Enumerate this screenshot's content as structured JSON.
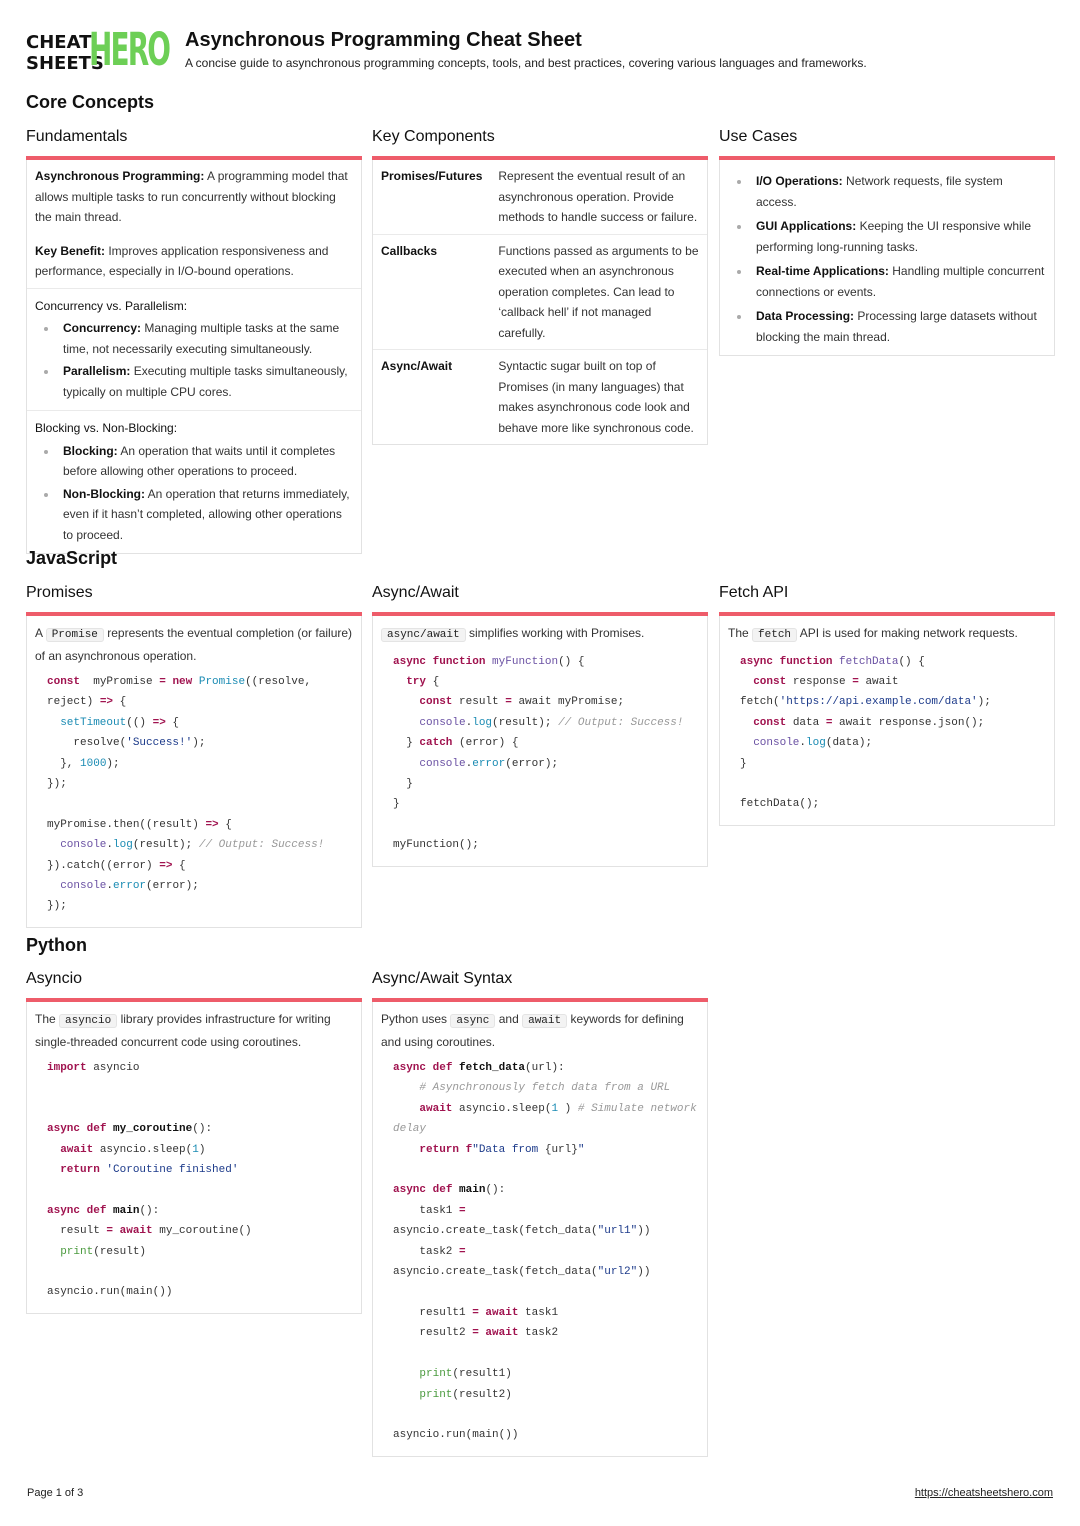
{
  "logo": {
    "line1": "CHEAT",
    "line2": "SHEETS",
    "hero": "HERO"
  },
  "header": {
    "title": "Asynchronous Programming Cheat Sheet",
    "subtitle": "A concise guide to asynchronous programming concepts, tools, and best practices, covering various languages and frameworks."
  },
  "sections": {
    "core": "Core Concepts",
    "javascript": "JavaScript",
    "python": "Python"
  },
  "fundamentals": {
    "title": "Fundamentals",
    "p1_bold": "Asynchronous Programming:",
    "p1_text": " A programming model that allows multiple tasks to run concurrently without blocking the main thread.",
    "p2_bold": "Key Benefit:",
    "p2_text": " Improves application responsiveness and performance, especially in I/O-bound operations.",
    "cp_heading": "Concurrency vs. Parallelism:",
    "cp_items": [
      {
        "bold": "Concurrency:",
        "text": " Managing multiple tasks at the same time, not necessarily executing simultaneously."
      },
      {
        "bold": "Parallelism:",
        "text": " Executing multiple tasks simultaneously, typically on multiple CPU cores."
      }
    ],
    "bn_heading": "Blocking vs. Non-Blocking:",
    "bn_items": [
      {
        "bold": "Blocking:",
        "text": " An operation that waits until it completes before allowing other operations to proceed."
      },
      {
        "bold": "Non-Blocking:",
        "text": " An operation that returns immediately, even if it hasn’t completed, allowing other operations to proceed."
      }
    ]
  },
  "key_components": {
    "title": "Key Components",
    "rows": [
      {
        "term": "Promises/Futures",
        "desc": "Represent the eventual result of an asynchronous operation. Provide methods to handle success or failure."
      },
      {
        "term": "Callbacks",
        "desc": "Functions passed as arguments to be executed when an asynchronous operation completes. Can lead to ‘callback hell’ if not managed carefully."
      },
      {
        "term": "Async/Await",
        "desc": "Syntactic sugar built on top of Promises (in many languages) that makes asynchronous code look and behave more like synchronous code."
      }
    ]
  },
  "use_cases": {
    "title": "Use Cases",
    "items": [
      {
        "bold": "I/O Operations:",
        "text": " Network requests, file system access."
      },
      {
        "bold": "GUI Applications:",
        "text": " Keeping the UI responsive while performing long-running tasks."
      },
      {
        "bold": "Real-time Applications:",
        "text": " Handling multiple concurrent connections or events."
      },
      {
        "bold": "Data Processing:",
        "text": " Processing large datasets without blocking the main thread."
      }
    ]
  },
  "promises": {
    "title": "Promises",
    "intro_pre": "A ",
    "intro_code": "Promise",
    "intro_post": " represents the eventual completion (or failure) of an asynchronous operation."
  },
  "js_async_await": {
    "title": "Async/Await",
    "intro_code": "async/await",
    "intro_post": " simplifies working with Promises."
  },
  "fetch_api": {
    "title": "Fetch API",
    "intro_pre": "The ",
    "intro_code": "fetch",
    "intro_post": " API is used for making network requests."
  },
  "asyncio": {
    "title": "Asyncio",
    "intro_pre": "The ",
    "intro_code": "asyncio",
    "intro_post": " library provides infrastructure for writing single-threaded concurrent code using coroutines."
  },
  "py_async_await": {
    "title": "Async/Await Syntax",
    "intro_pre": "Python uses ",
    "intro_code1": "async",
    "intro_mid": " and ",
    "intro_code2": "await",
    "intro_post": " keywords for defining and using coroutines."
  },
  "code": {
    "promises": [
      [
        [
          "kw",
          "const"
        ],
        [
          "",
          "  myPromise "
        ],
        [
          "op",
          "="
        ],
        [
          "",
          ""
        ],
        [
          "kw",
          " new"
        ],
        [
          "bi",
          " Promise"
        ],
        [
          "",
          "((resolve,"
        ]
      ],
      [
        [
          "",
          "reject) "
        ],
        [
          "op",
          "=>"
        ],
        [
          "",
          " {"
        ]
      ],
      [
        [
          "",
          "  "
        ],
        [
          "bi",
          "setTimeout"
        ],
        [
          "",
          "(() "
        ],
        [
          "op",
          "=>"
        ],
        [
          "",
          " {"
        ]
      ],
      [
        [
          "",
          "    resolve("
        ],
        [
          "str",
          "'Success!'"
        ],
        [
          "",
          ");"
        ]
      ],
      [
        [
          "",
          "  }, "
        ],
        [
          "num",
          "1000"
        ],
        [
          "",
          ");"
        ]
      ],
      [
        [
          "",
          "});"
        ]
      ],
      [
        [
          "",
          ""
        ]
      ],
      [
        [
          "",
          "myPromise.then((result) "
        ],
        [
          "op",
          "=>"
        ],
        [
          "",
          " {"
        ]
      ],
      [
        [
          "",
          "  "
        ],
        [
          "fn",
          "console"
        ],
        [
          "",
          "."
        ],
        [
          "bi",
          "log"
        ],
        [
          "",
          "(result); "
        ],
        [
          "cm",
          "// Output: Success!"
        ]
      ],
      [
        [
          "",
          "}).catch((error) "
        ],
        [
          "op",
          "=>"
        ],
        [
          "",
          " {"
        ]
      ],
      [
        [
          "",
          "  "
        ],
        [
          "fn",
          "console"
        ],
        [
          "",
          "."
        ],
        [
          "bi",
          "error"
        ],
        [
          "",
          "(error);"
        ]
      ],
      [
        [
          "",
          "});"
        ]
      ]
    ],
    "js_async_await": [
      [
        [
          "kw",
          "async"
        ],
        [
          "kw",
          " function"
        ],
        [
          "fn",
          " myFunction"
        ],
        [
          "",
          "() {"
        ]
      ],
      [
        [
          "",
          "  "
        ],
        [
          "kw",
          "try"
        ],
        [
          "",
          " {"
        ]
      ],
      [
        [
          "",
          "    "
        ],
        [
          "kw",
          "const"
        ],
        [
          "",
          " result "
        ],
        [
          "op",
          "="
        ],
        [
          "",
          " await myPromise;"
        ]
      ],
      [
        [
          "",
          "    "
        ],
        [
          "fn",
          "console"
        ],
        [
          "",
          "."
        ],
        [
          "bi",
          "log"
        ],
        [
          "",
          "(result); "
        ],
        [
          "cm",
          "// Output: Success!"
        ]
      ],
      [
        [
          "",
          "  } "
        ],
        [
          "kw",
          "catch"
        ],
        [
          "",
          " (error) {"
        ]
      ],
      [
        [
          "",
          "    "
        ],
        [
          "fn",
          "console"
        ],
        [
          "",
          "."
        ],
        [
          "bi",
          "error"
        ],
        [
          "",
          "(error);"
        ]
      ],
      [
        [
          "",
          "  }"
        ]
      ],
      [
        [
          "",
          "}"
        ]
      ],
      [
        [
          "",
          ""
        ]
      ],
      [
        [
          "",
          "myFunction();"
        ]
      ]
    ],
    "fetch_api": [
      [
        [
          "kw",
          "async"
        ],
        [
          "kw",
          " function"
        ],
        [
          "fn",
          " fetchData"
        ],
        [
          "",
          "() {"
        ]
      ],
      [
        [
          "",
          "  "
        ],
        [
          "kw",
          "const"
        ],
        [
          "",
          " response "
        ],
        [
          "op",
          "="
        ],
        [
          "",
          " await"
        ]
      ],
      [
        [
          "",
          "fetch("
        ],
        [
          "str",
          "'https://api.example.com/data'"
        ],
        [
          "",
          ");"
        ]
      ],
      [
        [
          "",
          "  "
        ],
        [
          "kw",
          "const"
        ],
        [
          "",
          " data "
        ],
        [
          "op",
          "="
        ],
        [
          "",
          " await response.json();"
        ]
      ],
      [
        [
          "",
          "  "
        ],
        [
          "fn",
          "console"
        ],
        [
          "",
          "."
        ],
        [
          "bi",
          "log"
        ],
        [
          "",
          "(data);"
        ]
      ],
      [
        [
          "",
          "}"
        ]
      ],
      [
        [
          "",
          ""
        ]
      ],
      [
        [
          "",
          "fetchData();"
        ]
      ]
    ],
    "asyncio": [
      [
        [
          "kw",
          "import"
        ],
        [
          "",
          " asyncio"
        ]
      ],
      [
        [
          "",
          ""
        ]
      ],
      [
        [
          "",
          ""
        ]
      ],
      [
        [
          "kw",
          "async"
        ],
        [
          "kw",
          " def"
        ],
        [
          "df",
          " my_coroutine"
        ],
        [
          "",
          "():"
        ]
      ],
      [
        [
          "",
          "  "
        ],
        [
          "kw",
          "await"
        ],
        [
          "",
          " asyncio.sleep("
        ],
        [
          "num",
          "1"
        ],
        [
          "",
          ")"
        ]
      ],
      [
        [
          "",
          "  "
        ],
        [
          "kw",
          "return"
        ],
        [
          "str",
          " 'Coroutine finished'"
        ]
      ],
      [
        [
          "",
          ""
        ]
      ],
      [
        [
          "kw",
          "async"
        ],
        [
          "kw",
          " def"
        ],
        [
          "df",
          " main"
        ],
        [
          "",
          "():"
        ]
      ],
      [
        [
          "",
          "  result "
        ],
        [
          "op",
          "="
        ],
        [
          "kw",
          " await"
        ],
        [
          "",
          " my_coroutine()"
        ]
      ],
      [
        [
          "",
          "  "
        ],
        [
          "pr",
          "print"
        ],
        [
          "",
          "(result)"
        ]
      ],
      [
        [
          "",
          ""
        ]
      ],
      [
        [
          "",
          "asyncio.run(main())"
        ]
      ]
    ],
    "py_async_await": [
      [
        [
          "kw",
          "async"
        ],
        [
          "kw",
          " def"
        ],
        [
          "df",
          " fetch_data"
        ],
        [
          "",
          "(url):"
        ]
      ],
      [
        [
          "",
          "    "
        ],
        [
          "cm",
          "# Asynchronously fetch data from a URL"
        ]
      ],
      [
        [
          "",
          "    "
        ],
        [
          "kw",
          "await"
        ],
        [
          "",
          " asyncio.sleep("
        ],
        [
          "num",
          "1"
        ],
        [
          "",
          " ) "
        ],
        [
          "cm",
          "# Simulate network"
        ]
      ],
      [
        [
          "cm",
          "delay"
        ]
      ],
      [
        [
          "",
          "    "
        ],
        [
          "kw",
          "return"
        ],
        [
          "kw",
          " f"
        ],
        [
          "str",
          "\"Data from "
        ],
        [
          "",
          "{url}"
        ],
        [
          "str",
          "\""
        ]
      ],
      [
        [
          "",
          ""
        ]
      ],
      [
        [
          "kw",
          "async"
        ],
        [
          "kw",
          " def"
        ],
        [
          "df",
          " main"
        ],
        [
          "",
          "():"
        ]
      ],
      [
        [
          "",
          "    task1 "
        ],
        [
          "op",
          "="
        ]
      ],
      [
        [
          "",
          "asyncio.create_task(fetch_data("
        ],
        [
          "str",
          "\"url1\""
        ],
        [
          "",
          "))"
        ]
      ],
      [
        [
          "",
          "    task2 "
        ],
        [
          "op",
          "="
        ]
      ],
      [
        [
          "",
          "asyncio.create_task(fetch_data("
        ],
        [
          "str",
          "\"url2\""
        ],
        [
          "",
          "))"
        ]
      ],
      [
        [
          "",
          ""
        ]
      ],
      [
        [
          "",
          "    result1 "
        ],
        [
          "op",
          "="
        ],
        [
          "kw",
          " await"
        ],
        [
          "",
          " task1"
        ]
      ],
      [
        [
          "",
          "    result2 "
        ],
        [
          "op",
          "="
        ],
        [
          "kw",
          " await"
        ],
        [
          "",
          " task2"
        ]
      ],
      [
        [
          "",
          ""
        ]
      ],
      [
        [
          "",
          "    "
        ],
        [
          "pr",
          "print"
        ],
        [
          "",
          "(result1)"
        ]
      ],
      [
        [
          "",
          "    "
        ],
        [
          "pr",
          "print"
        ],
        [
          "",
          "(result2)"
        ]
      ],
      [
        [
          "",
          ""
        ]
      ],
      [
        [
          "",
          "asyncio.run(main())"
        ]
      ]
    ]
  },
  "footer": {
    "page": "Page 1 of 3",
    "link": "https://cheatsheetshero.com"
  }
}
